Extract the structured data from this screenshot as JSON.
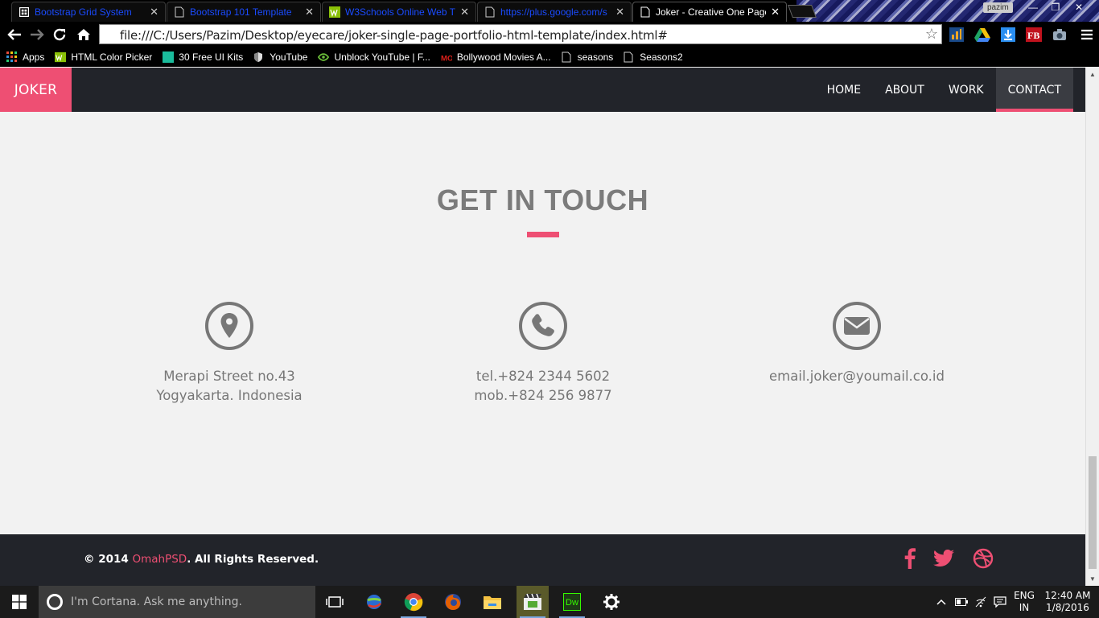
{
  "browser": {
    "tabs": [
      {
        "label": "Bootstrap Grid System",
        "icon": "grid-icon"
      },
      {
        "label": "Bootstrap 101 Template",
        "icon": "page-icon"
      },
      {
        "label": "W3Schools Online Web Tu",
        "icon": "w3schools-icon"
      },
      {
        "label": "https://plus.google.com/s",
        "icon": "page-icon"
      },
      {
        "label": "Joker - Creative One Page",
        "icon": "page-icon"
      }
    ],
    "user": "pazim",
    "address": "file:///C:/Users/Pazim/Desktop/eyecare/joker-single-page-portfolio-html-template/index.html#",
    "bookmarks": [
      {
        "label": "Apps",
        "icon": "apps-grid-icon"
      },
      {
        "label": "HTML Color Picker",
        "icon": "color-picker-icon"
      },
      {
        "label": "30 Free UI Kits",
        "icon": "ui-kits-icon"
      },
      {
        "label": "YouTube",
        "icon": "shield-icon"
      },
      {
        "label": "Unblock YouTube | F...",
        "icon": "unblock-icon"
      },
      {
        "label": "Bollywood Movies A...",
        "icon": "bollywood-icon"
      },
      {
        "label": "seasons",
        "icon": "page-icon"
      },
      {
        "label": "Seasons2",
        "icon": "page-icon"
      }
    ]
  },
  "site": {
    "brand": "JOKER",
    "menu": [
      "HOME",
      "ABOUT",
      "WORK",
      "CONTACT"
    ],
    "active_menu": "CONTACT",
    "section_title": "GET IN TOUCH",
    "contacts": [
      {
        "icon": "location-pin-icon",
        "lines": [
          "Merapi Street no.43",
          "Yogyakarta. Indonesia"
        ]
      },
      {
        "icon": "phone-icon",
        "lines": [
          "tel.+824 2344 5602",
          "mob.+824 256 9877"
        ]
      },
      {
        "icon": "email-icon",
        "lines": [
          "email.joker@youmail.co.id"
        ]
      }
    ],
    "footer": {
      "copyright_prefix": "© 2014 ",
      "copyright_link": "OmahPSD",
      "copyright_suffix": ". All Rights Reserved.",
      "social": [
        "facebook-icon",
        "twitter-icon",
        "dribbble-icon"
      ]
    },
    "accent_color": "#ee4f73",
    "dark_color": "#22242a"
  },
  "taskbar": {
    "search_placeholder": "I'm Cortana. Ask me anything.",
    "language": [
      "ENG",
      "IN"
    ],
    "time": "12:40 AM",
    "date": "1/8/2016"
  }
}
